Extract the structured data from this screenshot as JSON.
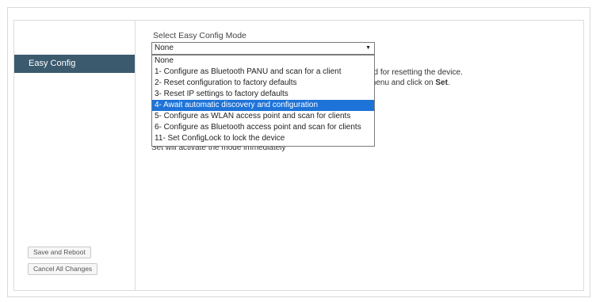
{
  "sidebar": {
    "active_item": "Easy Config",
    "save_button": "Save and Reboot",
    "cancel_button": "Cancel All Changes"
  },
  "main": {
    "select_label": "Select Easy Config Mode",
    "selected_value": "None",
    "background_text": [
      "nd for resetting the device.",
      "menu and click on",
      "Set",
      "Set will activate the mode immediately"
    ],
    "options": [
      "None",
      "1- Configure as Bluetooth PANU and scan for a client",
      "2- Reset configuration to factory defaults",
      "3- Reset IP settings to factory defaults",
      "4- Await automatic discovery and configuration",
      "5- Configure as WLAN access point and scan for clients",
      "6- Configure as Bluetooth access point and scan for clients",
      "11- Set ConfigLock to lock the device"
    ],
    "highlighted_index": 4
  },
  "colors": {
    "sidebar_active_bg": "#3b5a6e",
    "highlight": "#1e73d8"
  }
}
